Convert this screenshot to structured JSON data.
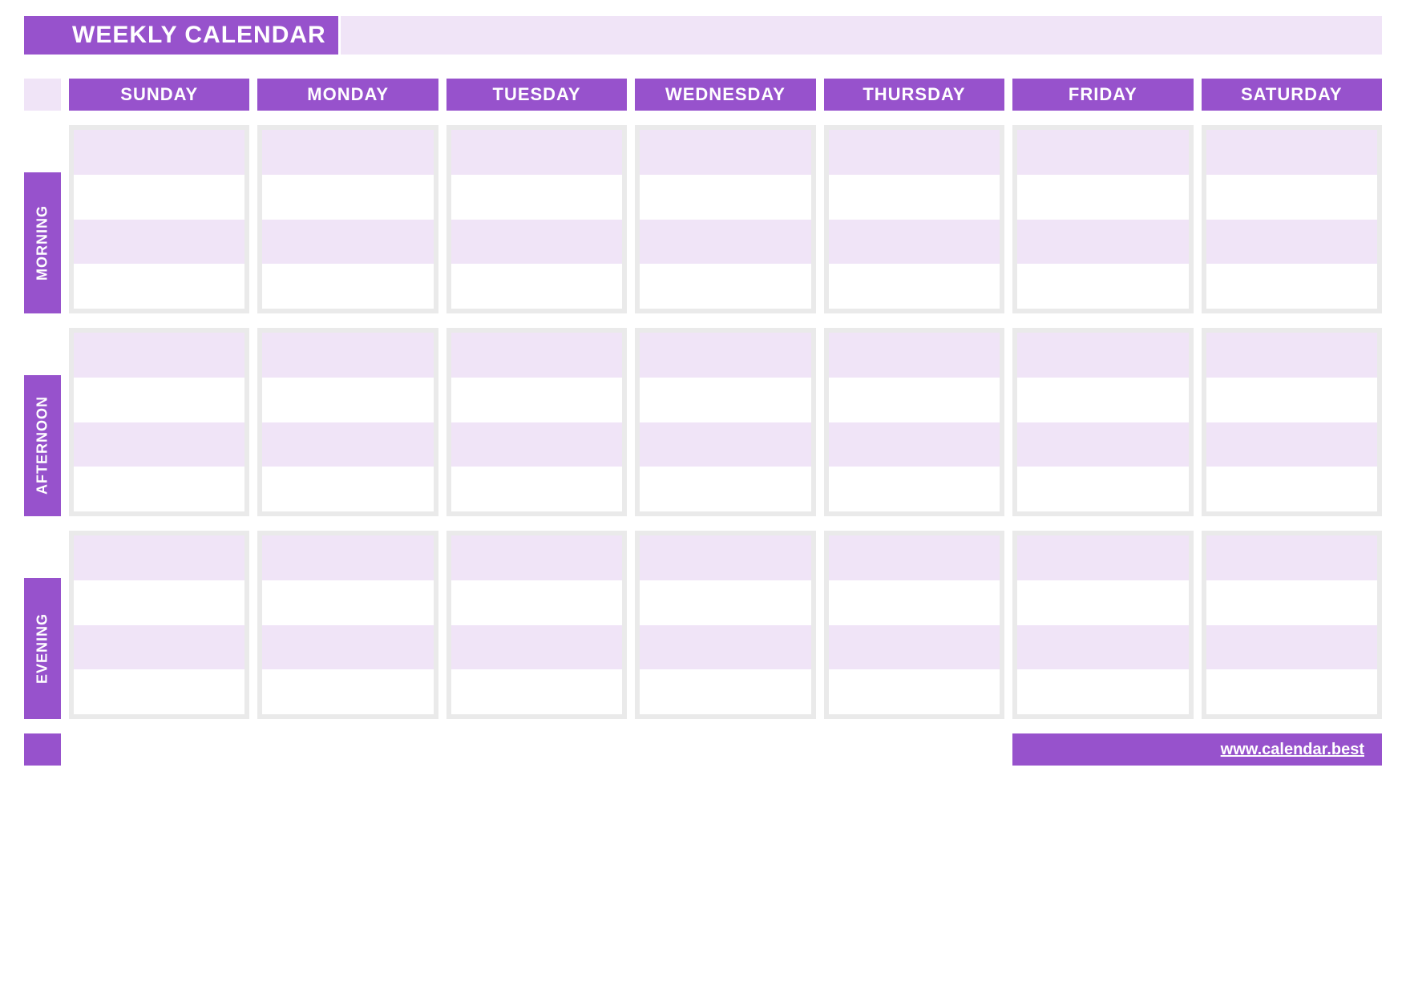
{
  "title": "WEEKLY CALENDAR",
  "days": [
    "SUNDAY",
    "MONDAY",
    "TUESDAY",
    "WEDNESDAY",
    "THURSDAY",
    "FRIDAY",
    "SATURDAY"
  ],
  "periods": [
    "MORNING",
    "AFTERNOON",
    "EVENING"
  ],
  "footer_link": "www.calendar.best",
  "colors": {
    "primary": "#9752cc",
    "light": "#f0e4f7",
    "border": "#eaeaea"
  }
}
